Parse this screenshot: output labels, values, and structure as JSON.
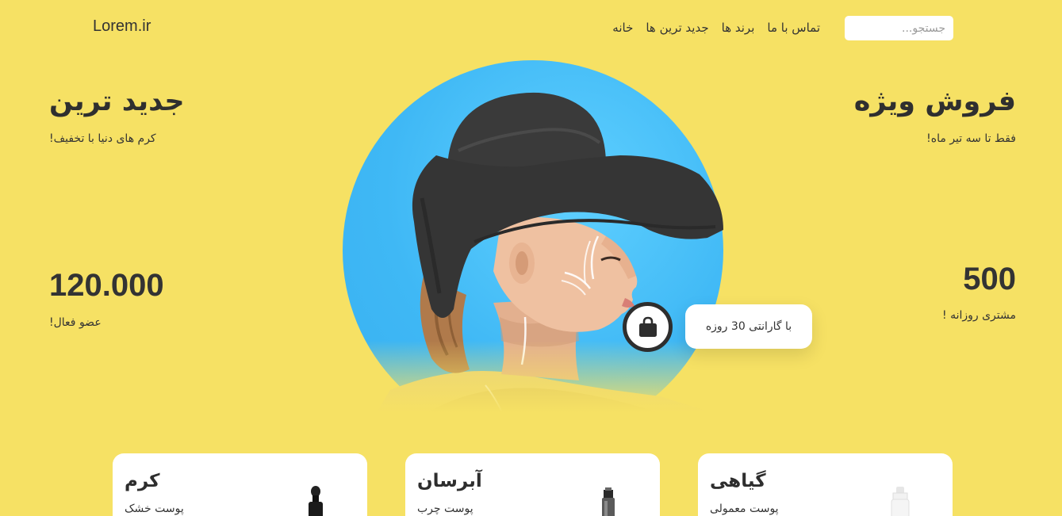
{
  "header": {
    "logo": "Lorem.ir",
    "nav": [
      "خانه",
      "جدید ترین ها",
      "برند ها",
      "تماس با ما"
    ],
    "search_placeholder": "جستجو..."
  },
  "hero": {
    "right": {
      "title": "فروش ویژه",
      "subtitle": "فقط تا سه تیر ماه!",
      "stat_value": "500",
      "stat_label": "مشتری روزانه !"
    },
    "left": {
      "title": "جدید ترین",
      "subtitle": "کرم های دنیا با تخفیف!",
      "stat_value": "120.000",
      "stat_label": "عضو فعال!"
    },
    "guarantee": "با گارانتی 30 روزه",
    "circle_color": "#3fb8f5"
  },
  "categories": [
    {
      "title": "کرم",
      "subtitle": "پوست خشک"
    },
    {
      "title": "آبرسان",
      "subtitle": "پوست چرب"
    },
    {
      "title": "گیاهی",
      "subtitle": "پوست معمولی"
    }
  ],
  "colors": {
    "background": "#f6e164",
    "text": "#2e2e2e",
    "card": "#ffffff"
  }
}
